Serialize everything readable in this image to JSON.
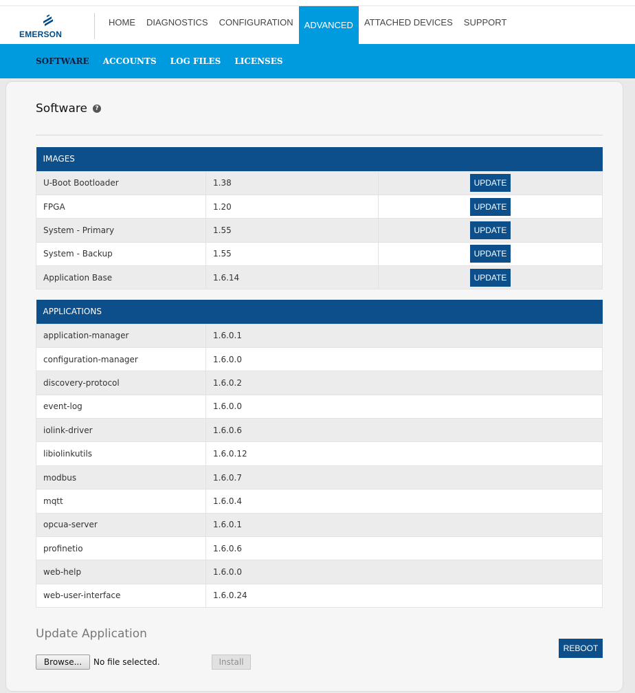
{
  "brand": {
    "name": "EMERSON",
    "color": "#004b87"
  },
  "colors": {
    "accent": "#009bdf",
    "header": "#0d4f8b"
  },
  "main_nav": [
    {
      "label": "HOME",
      "active": false
    },
    {
      "label": "DIAGNOSTICS",
      "active": false
    },
    {
      "label": "CONFIGURATION",
      "active": false
    },
    {
      "label": "ADVANCED",
      "active": true
    },
    {
      "label": "ATTACHED DEVICES",
      "active": false
    },
    {
      "label": "SUPPORT",
      "active": false
    }
  ],
  "sub_nav": [
    {
      "label": "SOFTWARE",
      "active": true
    },
    {
      "label": "ACCOUNTS",
      "active": false
    },
    {
      "label": "LOG FILES",
      "active": false
    },
    {
      "label": "LICENSES",
      "active": false
    }
  ],
  "page": {
    "title": "Software",
    "help_icon": "question-circle-icon"
  },
  "images": {
    "header": "IMAGES",
    "rows": [
      {
        "name": "U-Boot Bootloader",
        "version": "1.38",
        "action": "UPDATE"
      },
      {
        "name": "FPGA",
        "version": "1.20",
        "action": "UPDATE"
      },
      {
        "name": "System - Primary",
        "version": "1.55",
        "action": "UPDATE"
      },
      {
        "name": "System - Backup",
        "version": "1.55",
        "action": "UPDATE"
      },
      {
        "name": "Application Base",
        "version": "1.6.14",
        "action": "UPDATE"
      }
    ]
  },
  "applications": {
    "header": "APPLICATIONS",
    "rows": [
      {
        "name": "application-manager",
        "version": "1.6.0.1"
      },
      {
        "name": "configuration-manager",
        "version": "1.6.0.0"
      },
      {
        "name": "discovery-protocol",
        "version": "1.6.0.2"
      },
      {
        "name": "event-log",
        "version": "1.6.0.0"
      },
      {
        "name": "iolink-driver",
        "version": "1.6.0.6"
      },
      {
        "name": "libiolinkutils",
        "version": "1.6.0.12"
      },
      {
        "name": "modbus",
        "version": "1.6.0.7"
      },
      {
        "name": "mqtt",
        "version": "1.6.0.4"
      },
      {
        "name": "opcua-server",
        "version": "1.6.0.1"
      },
      {
        "name": "profinetio",
        "version": "1.6.0.6"
      },
      {
        "name": "web-help",
        "version": "1.6.0.0"
      },
      {
        "name": "web-user-interface",
        "version": "1.6.0.24"
      }
    ]
  },
  "update_app": {
    "title": "Update Application",
    "browse_label": "Browse...",
    "file_status": "No file selected.",
    "install_label": "Install",
    "reboot_label": "REBOOT"
  }
}
